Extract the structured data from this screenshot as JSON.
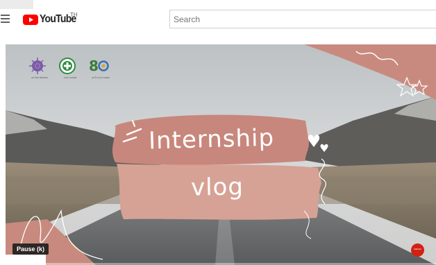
{
  "header": {
    "logo_text": "YouTube",
    "country_code": "TH",
    "search_placeholder": "Search"
  },
  "video": {
    "title_line1": "Internship",
    "title_line2": "vlog",
    "logos": [
      {
        "icon": "purple-flower-seal-icon",
        "caption": "มหาวิทยาลัยมหิดล"
      },
      {
        "icon": "green-health-emblem-icon",
        "caption": "กรมการแพทย์"
      },
      {
        "icon": "80-anniversary-icon",
        "caption": "80 ปี กรมการแพทย์"
      }
    ],
    "badge_text": "Mahidol",
    "progress": 0.0
  },
  "player": {
    "tooltip": "Pause (k)"
  },
  "colors": {
    "youtube_red": "#ff0000",
    "brush_pink": "#c8877c",
    "brush_light": "#d6a295"
  }
}
